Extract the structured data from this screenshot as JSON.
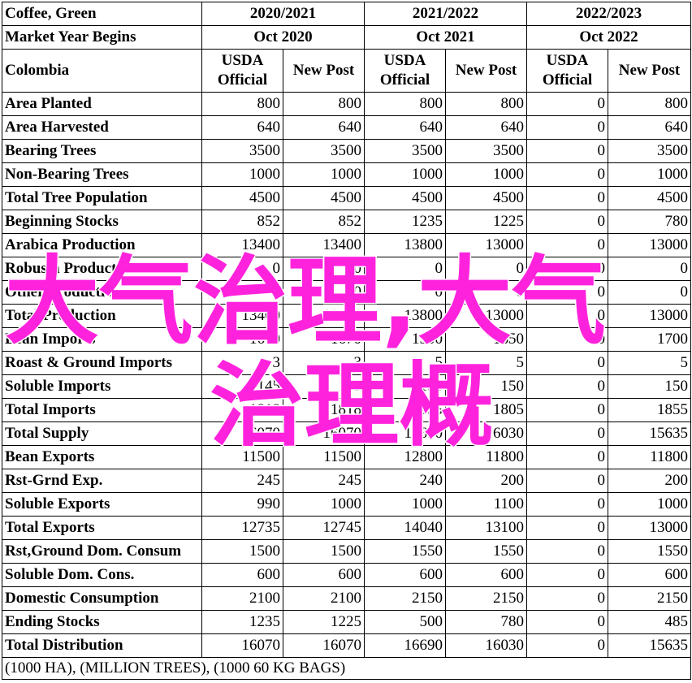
{
  "header": {
    "commodity": "Coffee, Green",
    "market_year_label": "Market Year Begins",
    "country": "Colombia",
    "years": [
      {
        "label": "2020/2021",
        "begins": "Oct 2020"
      },
      {
        "label": "2021/2022",
        "begins": "Oct 2021"
      },
      {
        "label": "2022/2023",
        "begins": "Oct 2022"
      }
    ],
    "col_usda_line1": "USDA",
    "col_usda_line2": "Official",
    "col_new_post": "New Post"
  },
  "rows": [
    {
      "label": "Area Planted",
      "values": [
        "800",
        "800",
        "800",
        "800",
        "0",
        "800"
      ]
    },
    {
      "label": "Area Harvested",
      "values": [
        "640",
        "640",
        "640",
        "640",
        "0",
        "640"
      ]
    },
    {
      "label": "Bearing Trees",
      "values": [
        "3500",
        "3500",
        "3500",
        "3500",
        "0",
        "3500"
      ]
    },
    {
      "label": "Non-Bearing Trees",
      "values": [
        "1000",
        "1000",
        "1000",
        "1000",
        "0",
        "1000"
      ]
    },
    {
      "label": "Total Tree Population",
      "values": [
        "4500",
        "4500",
        "4500",
        "4500",
        "0",
        "4500"
      ]
    },
    {
      "label": "Beginning Stocks",
      "values": [
        "852",
        "852",
        "1235",
        "1225",
        "0",
        "780"
      ]
    },
    {
      "label": "Arabica Production",
      "values": [
        "13400",
        "13400",
        "13800",
        "13000",
        "0",
        "13000"
      ]
    },
    {
      "label": "Robusta Production",
      "values": [
        "0",
        "0",
        "0",
        "0",
        "0",
        "0"
      ]
    },
    {
      "label": "Other Production",
      "values": [
        "0",
        "0",
        "0",
        "0",
        "0",
        "0"
      ]
    },
    {
      "label": "Total Production",
      "values": [
        "13400",
        "13400",
        "13800",
        "13000",
        "0",
        "13000"
      ]
    },
    {
      "label": "Bean Imports",
      "values": [
        "1670",
        "1670",
        "1500",
        "1650",
        "0",
        "1700"
      ]
    },
    {
      "label": "Roast & Ground Imports",
      "values": [
        "3",
        "3",
        "5",
        "5",
        "0",
        "5"
      ]
    },
    {
      "label": "Soluble Imports",
      "values": [
        "145",
        "145",
        "150",
        "150",
        "0",
        "150"
      ]
    },
    {
      "label": "Total Imports",
      "values": [
        "1818",
        "1818",
        "1655",
        "1805",
        "0",
        "1855"
      ]
    },
    {
      "label": "Total Supply",
      "values": [
        "16070",
        "16070",
        "16690",
        "16030",
        "0",
        "15635"
      ]
    },
    {
      "label": "Bean Exports",
      "values": [
        "11500",
        "11500",
        "12800",
        "11800",
        "0",
        "11800"
      ]
    },
    {
      "label": "Rst-Grnd Exp.",
      "values": [
        "245",
        "245",
        "240",
        "200",
        "0",
        "200"
      ]
    },
    {
      "label": "Soluble Exports",
      "values": [
        "990",
        "1000",
        "1000",
        "1100",
        "0",
        "1000"
      ]
    },
    {
      "label": "Total Exports",
      "values": [
        "12735",
        "12745",
        "14040",
        "13100",
        "0",
        "13000"
      ]
    },
    {
      "label": "Rst,Ground Dom. Consum",
      "values": [
        "1500",
        "1500",
        "1550",
        "1550",
        "0",
        "1550"
      ]
    },
    {
      "label": "Soluble Dom. Cons.",
      "values": [
        "600",
        "600",
        "600",
        "600",
        "0",
        "600"
      ]
    },
    {
      "label": "Domestic Consumption",
      "values": [
        "2100",
        "2100",
        "2150",
        "2150",
        "0",
        "2150"
      ]
    },
    {
      "label": "Ending Stocks",
      "values": [
        "1235",
        "1225",
        "500",
        "780",
        "0",
        "485"
      ]
    },
    {
      "label": "Total Distribution",
      "values": [
        "16070",
        "16070",
        "16690",
        "16030",
        "0",
        "15635"
      ]
    }
  ],
  "footnote": "(1000 HA), (MILLION TREES), (1000 60 KG BAGS)",
  "watermark": {
    "line1": "大气治理,大气",
    "line2": "治理概",
    "color": "#ff22dd"
  }
}
